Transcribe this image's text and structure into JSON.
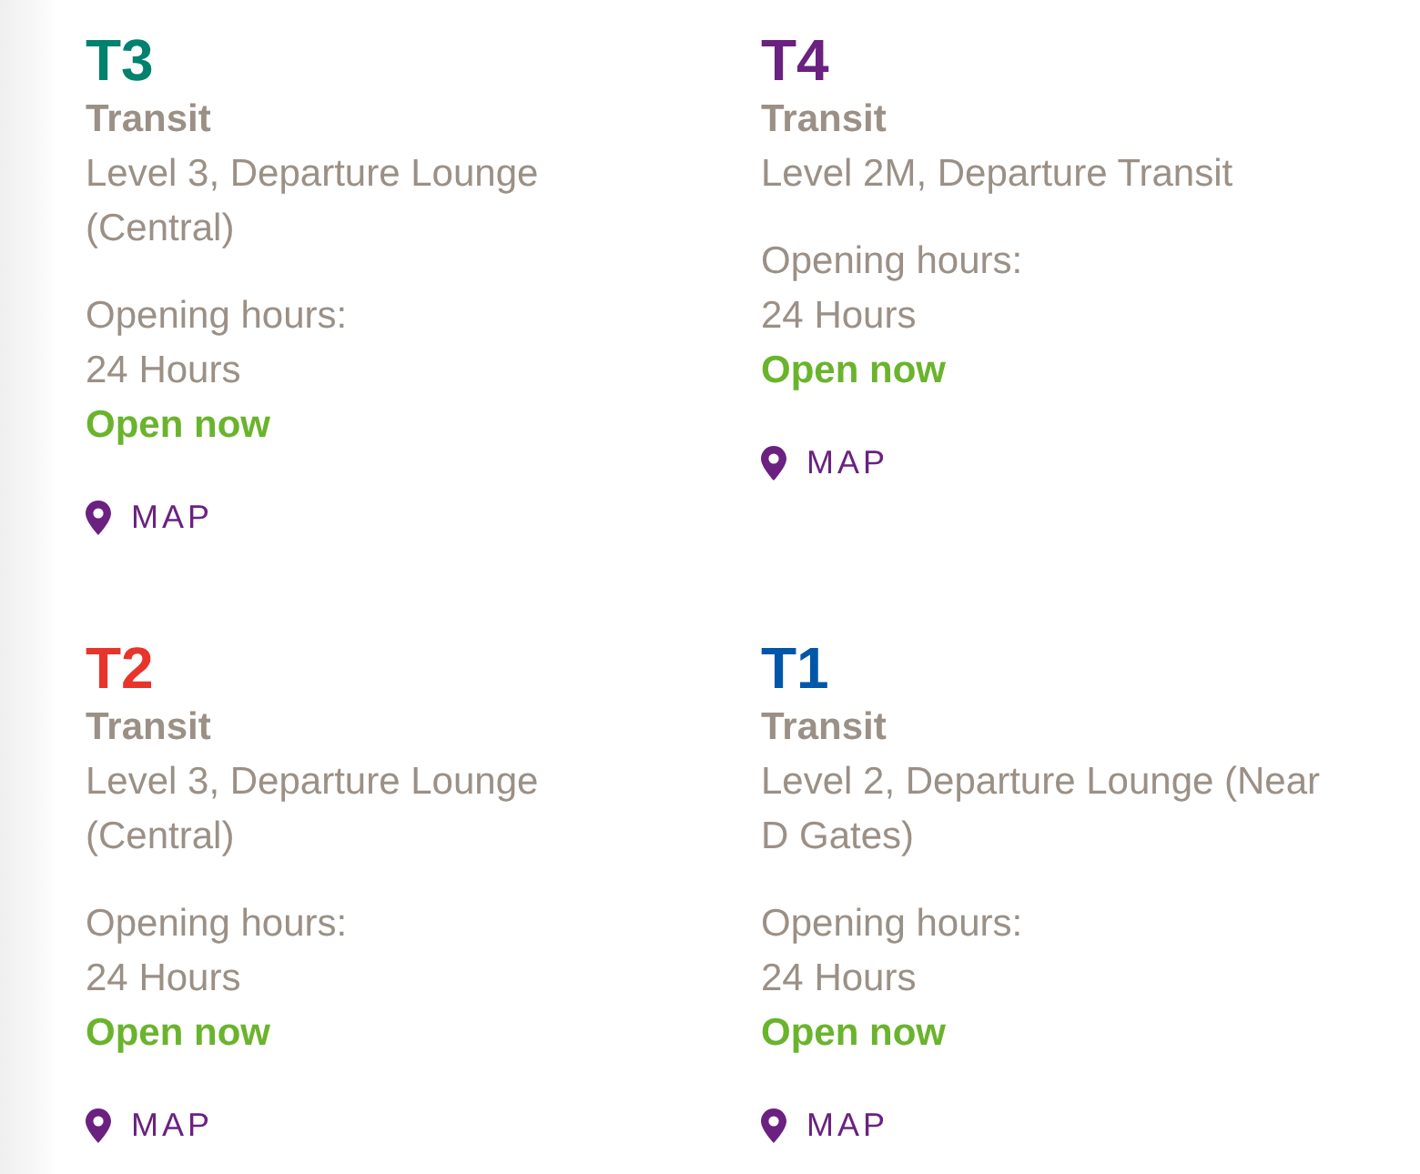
{
  "terminals": [
    {
      "name": "T3",
      "color": "#00826f",
      "category": "Transit",
      "location": "Level 3, Departure Lounge (Central)",
      "hours_label": "Opening hours:",
      "hours": "24 Hours",
      "status": "Open now",
      "map_link": "MAP"
    },
    {
      "name": "T4",
      "color": "#6b2180",
      "category": "Transit",
      "location": "Level 2M, Departure Transit",
      "hours_label": "Opening hours:",
      "hours": "24 Hours",
      "status": "Open now",
      "map_link": "MAP"
    },
    {
      "name": "T2",
      "color": "#e8342b",
      "category": "Transit",
      "location": "Level 3, Departure Lounge (Central)",
      "hours_label": "Opening hours:",
      "hours": "24 Hours",
      "status": "Open now",
      "map_link": "MAP"
    },
    {
      "name": "T1",
      "color": "#0057a8",
      "category": "Transit",
      "location": "Level 2, Departure Lounge (Near D Gates)",
      "hours_label": "Opening hours:",
      "hours": "24 Hours",
      "status": "Open now",
      "map_link": "MAP"
    }
  ]
}
